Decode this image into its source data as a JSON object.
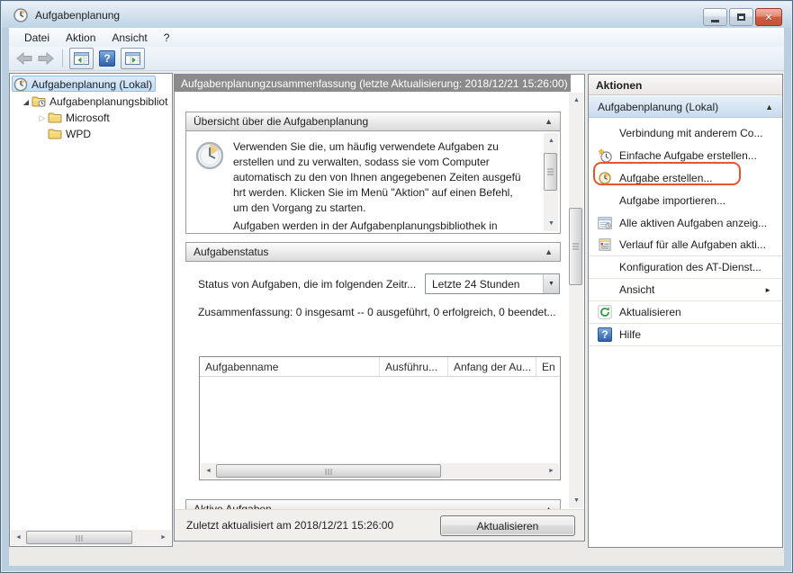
{
  "window": {
    "title": "Aufgabenplanung",
    "menu": [
      "Datei",
      "Aktion",
      "Ansicht",
      "?"
    ],
    "controls": {
      "minimize": "minimize",
      "maximize": "maximize",
      "close": "x"
    }
  },
  "glyphs": {
    "up": "▲",
    "down": "▼",
    "left": "◄",
    "right": "►",
    "expanded": "◢",
    "collapsed": "▷",
    "question": "?"
  },
  "colors": {
    "highlight_orange": "#e8542c",
    "main_header_gray": "#8b8b8b",
    "titlebar_blue": "#bfd4e4",
    "selection_blue": "#c4ddf3"
  },
  "tree": {
    "root": "Aufgabenplanung (Lokal)",
    "library": "Aufgabenplanungsbibliot",
    "children": [
      "Microsoft",
      "WPD"
    ]
  },
  "main": {
    "header": "Aufgabenplanungzusammenfassung (letzte Aktualisierung: 2018/12/21 15:26:00)",
    "overview": {
      "title": "Übersicht über die Aufgabenplanung",
      "para1": "Verwenden Sie die, um häufig verwendete Aufgaben zu\nerstellen und zu verwalten, sodass sie vom Computer\nautomatisch zu den von Ihnen angegebenen Zeiten ausgefü\nhrt werden. Klicken Sie im Menü \"Aktion\" auf einen Befehl,\num den Vorgang zu starten.",
      "para2": "Aufgaben werden in der Aufgabenplanungsbibliothek in"
    },
    "status": {
      "title": "Aufgabenstatus",
      "filter_label": "Status von Aufgaben, die im folgenden Zeitr...",
      "filter_value": "Letzte 24 Stunden",
      "summary": "Zusammenfassung: 0 insgesamt -- 0 ausgeführt, 0 erfolgreich, 0 beendet...",
      "columns": [
        "Aufgabenname",
        "Ausführu...",
        "Anfang der Au...",
        "En"
      ]
    },
    "active_tasks": {
      "title": "Aktive Aufgaben"
    },
    "statusbar": {
      "text": "Zuletzt aktualisiert am 2018/12/21 15:26:00",
      "refresh_button": "Aktualisieren"
    }
  },
  "actions": {
    "title": "Aktionen",
    "group": "Aufgabenplanung (Lokal)",
    "items": [
      {
        "label": "Verbindung mit anderem Co...",
        "icon": "none"
      },
      {
        "label": "Einfache Aufgabe erstellen...",
        "icon": "task-new-wizard-icon"
      },
      {
        "label": "Aufgabe erstellen...",
        "icon": "task-create-icon",
        "highlighted": true
      },
      {
        "label": "Aufgabe importieren...",
        "icon": "none"
      },
      {
        "label": "Alle aktiven Aufgaben anzeig...",
        "icon": "running-tasks-icon"
      },
      {
        "label": "Verlauf für alle Aufgaben akti...",
        "icon": "history-icon"
      },
      {
        "label": "Konfiguration des AT-Dienst...",
        "icon": "none"
      },
      {
        "label": "Ansicht",
        "icon": "none",
        "submenu": true
      },
      {
        "label": "Aktualisieren",
        "icon": "refresh-icon"
      },
      {
        "label": "Hilfe",
        "icon": "help-icon"
      }
    ]
  }
}
